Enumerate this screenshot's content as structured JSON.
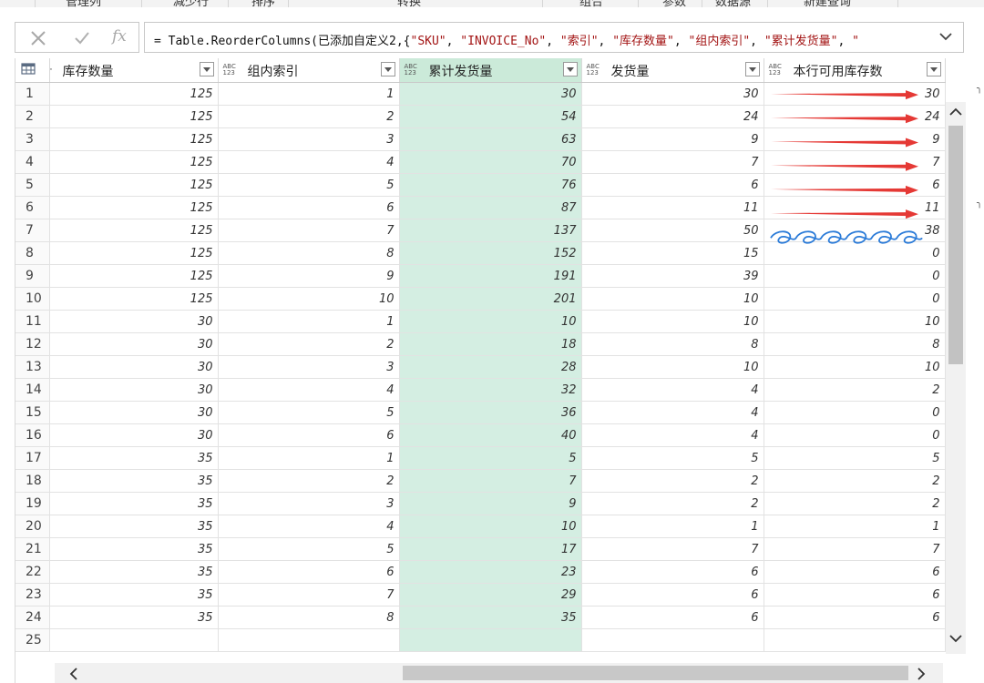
{
  "ribbon": {
    "groups": [
      "管理列",
      "减少行",
      "排序",
      "转换",
      "组合",
      "参数",
      "数据源",
      "新建查询"
    ]
  },
  "formula_bar": {
    "cancel_icon": "close-icon",
    "confirm_icon": "check-icon",
    "fx_label": "fx",
    "prefix": "= Table.ReorderColumns(已添加自定义2,{",
    "tokens": [
      "\"SKU\"",
      "\"INVOICE_No\"",
      "\"索引\"",
      "\"库存数量\"",
      "\"组内索引\"",
      "\"累计发货量\"",
      "\""
    ]
  },
  "table": {
    "columns": [
      {
        "name": "库存数量",
        "type": "1.2"
      },
      {
        "name": "组内索引",
        "type": "ABC123"
      },
      {
        "name": "累计发货量",
        "type": "ABC123"
      },
      {
        "name": "发货量",
        "type": "ABC123"
      },
      {
        "name": "本行可用库存数",
        "type": "ABC123"
      }
    ],
    "selected_column": "累计发货量",
    "rows": [
      [
        "1",
        "125",
        "1",
        "30",
        "30",
        "30"
      ],
      [
        "2",
        "125",
        "2",
        "54",
        "24",
        "24"
      ],
      [
        "3",
        "125",
        "3",
        "63",
        "9",
        "9"
      ],
      [
        "4",
        "125",
        "4",
        "70",
        "7",
        "7"
      ],
      [
        "5",
        "125",
        "5",
        "76",
        "6",
        "6"
      ],
      [
        "6",
        "125",
        "6",
        "87",
        "11",
        "11"
      ],
      [
        "7",
        "125",
        "7",
        "137",
        "50",
        "38"
      ],
      [
        "8",
        "125",
        "8",
        "152",
        "15",
        "0"
      ],
      [
        "9",
        "125",
        "9",
        "191",
        "39",
        "0"
      ],
      [
        "10",
        "125",
        "10",
        "201",
        "10",
        "0"
      ],
      [
        "11",
        "30",
        "1",
        "10",
        "10",
        "10"
      ],
      [
        "12",
        "30",
        "2",
        "18",
        "8",
        "8"
      ],
      [
        "13",
        "30",
        "3",
        "28",
        "10",
        "10"
      ],
      [
        "14",
        "30",
        "4",
        "32",
        "4",
        "2"
      ],
      [
        "15",
        "30",
        "5",
        "36",
        "4",
        "0"
      ],
      [
        "16",
        "30",
        "6",
        "40",
        "4",
        "0"
      ],
      [
        "17",
        "35",
        "1",
        "5",
        "5",
        "5"
      ],
      [
        "18",
        "35",
        "2",
        "7",
        "2",
        "2"
      ],
      [
        "19",
        "35",
        "3",
        "9",
        "2",
        "2"
      ],
      [
        "20",
        "35",
        "4",
        "10",
        "1",
        "1"
      ],
      [
        "21",
        "35",
        "5",
        "17",
        "7",
        "7"
      ],
      [
        "22",
        "35",
        "6",
        "23",
        "6",
        "6"
      ],
      [
        "23",
        "35",
        "7",
        "29",
        "6",
        "6"
      ],
      [
        "24",
        "35",
        "8",
        "35",
        "6",
        "6"
      ],
      [
        "25",
        "",
        "",
        "",
        "",
        ""
      ]
    ]
  },
  "annotations": {
    "arrow_color": "#e53935",
    "squiggle_color": "#2b7bd8",
    "arrow_rows": [
      "1",
      "2",
      "3",
      "4",
      "5",
      "6"
    ],
    "squiggle_row": "7"
  },
  "scroll": {
    "up_icon": "chevron-up-icon",
    "down_icon": "chevron-down-icon",
    "left_icon": "chevron-left-icon",
    "right_icon": "chevron-right-icon"
  }
}
